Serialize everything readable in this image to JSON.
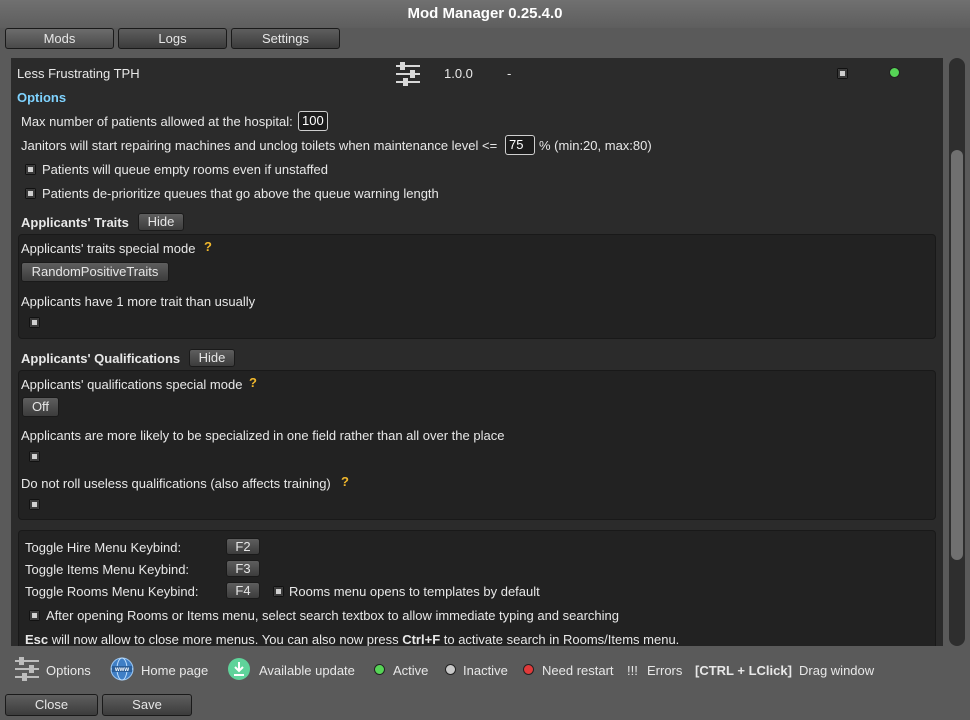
{
  "window": {
    "title": "Mod Manager 0.25.4.0"
  },
  "tabs": [
    {
      "label": "Mods",
      "active": true
    },
    {
      "label": "Logs",
      "active": false
    },
    {
      "label": "Settings",
      "active": false
    }
  ],
  "mod": {
    "name": "Less Frustrating TPH",
    "version": "1.0.0",
    "extra": "-",
    "enabled": false,
    "status_color": "#56d456"
  },
  "options": {
    "heading": "Options",
    "max_patients_label": "Max number of patients allowed at the hospital:",
    "max_patients_value": "100",
    "janitor_label": "Janitors will start repairing machines and unclog toilets when maintenance level <=",
    "janitor_value": "75",
    "janitor_suffix": "% (min:20, max:80)",
    "queue_empty_rooms": "Patients will queue empty rooms even if unstaffed",
    "deprioritize": "Patients de-prioritize queues that go above the queue warning length"
  },
  "traits": {
    "heading": "Applicants' Traits",
    "hide_label": "Hide",
    "mode_label": "Applicants' traits special mode",
    "help": "?",
    "mode_value": "RandomPositiveTraits",
    "more_trait_label": "Applicants have 1 more trait than usually"
  },
  "qualifications": {
    "heading": "Applicants' Qualifications",
    "hide_label": "Hide",
    "mode_label": "Applicants' qualifications special mode",
    "help": "?",
    "mode_value": "Off",
    "specialized_label": "Applicants are more likely to be specialized in one field rather than all over the place",
    "no_useless_label": "Do not roll useless qualifications (also affects training)",
    "help2": "?"
  },
  "keybinds": {
    "hire_label": "Toggle Hire Menu Keybind:",
    "hire_key": "F2",
    "items_label": "Toggle Items Menu Keybind:",
    "items_key": "F3",
    "rooms_label": "Toggle Rooms Menu Keybind:",
    "rooms_key": "F4",
    "rooms_templates": "Rooms menu opens to templates by default",
    "search_textbox": "After opening Rooms or Items menu, select search textbox to allow immediate typing and searching",
    "esc_bold": "Esc",
    "esc_text": " will now allow to close more menus. You can also now press ",
    "ctrlf_bold": "Ctrl+F",
    "ctrlf_text": " to activate search in Rooms/Items menu."
  },
  "legend": {
    "options": "Options",
    "homepage": "Home page",
    "update": "Available update",
    "active": "Active",
    "inactive": "Inactive",
    "restart": "Need restart",
    "errors_mark": "!!!",
    "errors": "Errors",
    "drag_keys": "[CTRL + LClick]",
    "drag": "Drag window",
    "www": "www",
    "colors": {
      "active": "#56d456",
      "inactive": "#c8c8c8",
      "restart": "#e03a3a",
      "update": "#5fd39a"
    }
  },
  "footer": {
    "close": "Close",
    "save": "Save"
  }
}
